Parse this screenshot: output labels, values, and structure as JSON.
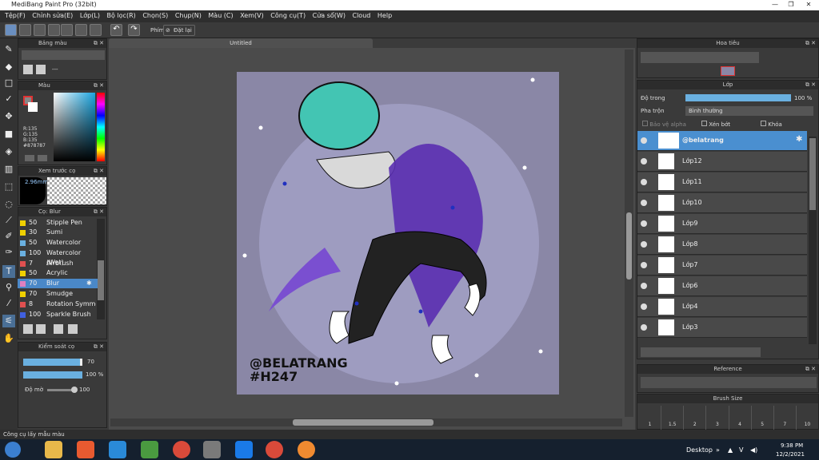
{
  "app": {
    "title": "MediBang Paint Pro (32bit)",
    "document_tab": "Untitled"
  },
  "menu": [
    "Tệp(F)",
    "Chỉnh sửa(E)",
    "Lớp(L)",
    "Bộ lọc(R)",
    "Chọn(S)",
    "Chụp(N)",
    "Màu (C)",
    "Xem(V)",
    "Công cụ(T)",
    "Cửa sổ(W)",
    "Cloud",
    "Help"
  ],
  "toolbar": {
    "phim_label": "Phím",
    "reset_label": "Đặt lại"
  },
  "panels": {
    "palette": {
      "title": "Bảng màu",
      "more": "---"
    },
    "color": {
      "title": "Màu",
      "r": "R:135",
      "g": "G:135",
      "b": "B:135",
      "hex": "#878787"
    },
    "preview": {
      "title": "Xem trước cọ",
      "size": "2.96mm"
    },
    "brush": {
      "title": "Cọ: Blur"
    },
    "brush_control": {
      "title": "Kiểm soát cọ",
      "size_val": "70",
      "opacity_val": "100 %",
      "blur_label": "Độ mờ",
      "blur_val": "100"
    },
    "navigator": {
      "title": "Hoa tiêu"
    },
    "layers": {
      "title": "Lớp",
      "opacity_label": "Độ trong",
      "opacity_val": "100 %",
      "blend_label": "Pha trộn",
      "blend_val": "Bình thường",
      "protect_alpha": "Bảo vệ alpha",
      "clip": "Xén bớt",
      "lock": "Khóa"
    },
    "reference": {
      "title": "Reference"
    },
    "brush_size": {
      "title": "Brush Size",
      "sizes": [
        "1",
        "1.5",
        "2",
        "3",
        "4",
        "5",
        "7",
        "10"
      ]
    }
  },
  "brushes": [
    {
      "size": "50",
      "name": "Stipple Pen",
      "color": "#f0d000"
    },
    {
      "size": "30",
      "name": "Sumi",
      "color": "#f0d000"
    },
    {
      "size": "50",
      "name": "Watercolor",
      "color": "#6ab0e0"
    },
    {
      "size": "100",
      "name": "Watercolor (Wet)",
      "color": "#6ab0e0"
    },
    {
      "size": "7",
      "name": "Airbrush",
      "color": "#e05050"
    },
    {
      "size": "50",
      "name": "Acrylic",
      "color": "#f0d000"
    },
    {
      "size": "70",
      "name": "Blur",
      "color": "#e080c0"
    },
    {
      "size": "70",
      "name": "Smudge",
      "color": "#f0d000"
    },
    {
      "size": "8",
      "name": "Rotation Symmetry",
      "color": "#e05050"
    },
    {
      "size": "100",
      "name": "Sparkle Brush",
      "color": "#4060e0"
    }
  ],
  "layers": [
    "@belatrang",
    "Lớp12",
    "Lớp11",
    "Lớp10",
    "Lớp9",
    "Lớp8",
    "Lớp7",
    "Lớp6",
    "Lớp4",
    "Lớp3"
  ],
  "canvas_text": [
    "@BELATRANG",
    "#H247"
  ],
  "status": {
    "text": "Công cụ lấy mẫu màu"
  },
  "taskbar": {
    "desktop": "Desktop",
    "time": "9:38 PM",
    "date": "12/2/2021"
  }
}
